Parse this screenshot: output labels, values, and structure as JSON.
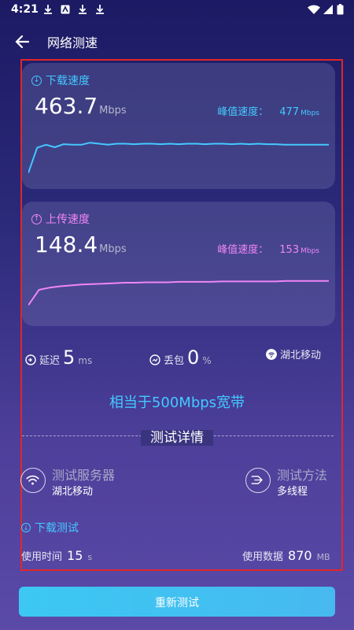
{
  "statusbar": {
    "time": "4:21"
  },
  "appbar": {
    "title": "网络测速"
  },
  "download": {
    "label": "下载速度",
    "value": "463.7",
    "unit": "Mbps",
    "peak_label": "峰值速度：",
    "peak_value": "477",
    "peak_unit": "Mbps",
    "color": "#43c9ff",
    "series": [
      0.1,
      0.6,
      0.66,
      0.61,
      0.67,
      0.66,
      0.66,
      0.7,
      0.68,
      0.66,
      0.68,
      0.68,
      0.67,
      0.68,
      0.68,
      0.67,
      0.68,
      0.67,
      0.68,
      0.68,
      0.67,
      0.68,
      0.68,
      0.67,
      0.68,
      0.67,
      0.68,
      0.67,
      0.67,
      0.66,
      0.66,
      0.66,
      0.66,
      0.66,
      0.66
    ]
  },
  "upload": {
    "label": "上传速度",
    "value": "148.4",
    "unit": "Mbps",
    "peak_label": "峰值速度：",
    "peak_value": "153",
    "peak_unit": "Mbps",
    "color": "#ee86f5",
    "series": [
      0.15,
      0.5,
      0.55,
      0.58,
      0.6,
      0.62,
      0.63,
      0.64,
      0.65,
      0.66,
      0.66,
      0.67,
      0.67,
      0.67,
      0.68,
      0.68,
      0.68,
      0.68,
      0.69,
      0.69,
      0.69,
      0.69,
      0.69,
      0.69,
      0.7,
      0.7,
      0.7,
      0.7,
      0.7
    ]
  },
  "stats": {
    "latency_label": "延迟",
    "latency_value": "5",
    "latency_unit": "ms",
    "loss_label": "丢包",
    "loss_value": "0",
    "loss_unit": "%",
    "carrier": "湖北移动"
  },
  "equivalent": "相当于500Mbps宽带",
  "details": {
    "title": "测试详情",
    "server_label": "测试服务器",
    "server_value": "湖北移动",
    "method_label": "测试方法",
    "method_value": "多线程"
  },
  "download_test": {
    "title": "下载测试",
    "time_label": "使用时间",
    "time_value": "15",
    "time_unit": "s",
    "data_label": "使用数据",
    "data_value": "870",
    "data_unit": "MB"
  },
  "retest_label": "重新测试"
}
